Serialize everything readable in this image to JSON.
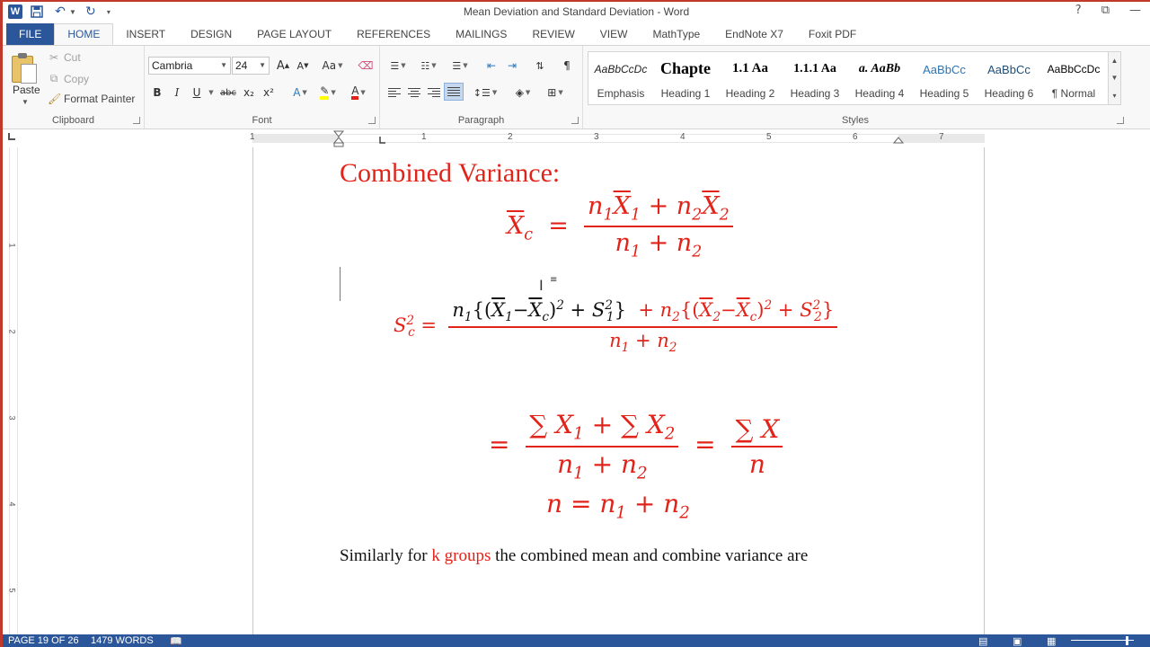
{
  "window": {
    "title": "Mean Deviation and Standard Deviation - Word",
    "controls": [
      "?",
      "⧉",
      "—"
    ]
  },
  "quick_access": {
    "app_logo": "W",
    "save_icon": "save-icon",
    "undo_icon": "undo-icon",
    "redo_icon": "redo-icon"
  },
  "tabs": [
    {
      "label": "FILE"
    },
    {
      "label": "HOME"
    },
    {
      "label": "INSERT"
    },
    {
      "label": "DESIGN"
    },
    {
      "label": "PAGE LAYOUT"
    },
    {
      "label": "REFERENCES"
    },
    {
      "label": "MAILINGS"
    },
    {
      "label": "REVIEW"
    },
    {
      "label": "VIEW"
    },
    {
      "label": "MathType"
    },
    {
      "label": "EndNote X7"
    },
    {
      "label": "Foxit PDF"
    }
  ],
  "clipboard": {
    "paste": "Paste",
    "cut": "Cut",
    "copy": "Copy",
    "format_painter": "Format Painter",
    "group_label": "Clipboard"
  },
  "font": {
    "font_name": "Cambria",
    "font_size": "24",
    "grow": "A",
    "shrink": "A",
    "change_case": "Aa",
    "bold": "B",
    "italic": "I",
    "underline": "U",
    "strikethrough": "abc",
    "subscript": "x₂",
    "superscript": "x²",
    "text_effects": "A",
    "font_color": "A",
    "group_label": "Font"
  },
  "paragraph": {
    "show_marks": "¶",
    "group_label": "Paragraph"
  },
  "styles": {
    "items": [
      {
        "sample": "AaBbCcDc",
        "name": "Emphasis"
      },
      {
        "sample": "Chapte",
        "name": "Heading 1"
      },
      {
        "sample": "1.1  Aa",
        "name": "Heading 2"
      },
      {
        "sample": "1.1.1  Aa",
        "name": "Heading 3"
      },
      {
        "sample": "a.  AaBb",
        "name": "Heading 4"
      },
      {
        "sample": "AaBbCc",
        "name": "Heading 5"
      },
      {
        "sample": "AaBbCc",
        "name": "Heading 6"
      },
      {
        "sample": "AaBbCcDc",
        "name": "¶ Normal"
      }
    ],
    "group_label": "Styles"
  },
  "ruler": {
    "numbers": [
      "1",
      "1",
      "2",
      "3",
      "4",
      "5",
      "6",
      "7"
    ],
    "vertical_numbers": [
      "1",
      "2",
      "3",
      "4",
      "5"
    ]
  },
  "document": {
    "heading": "Combined Variance:",
    "para_before": "Similarly for ",
    "para_highlight": "k groups",
    "para_after": " the combined mean and combine variance are"
  },
  "statusbar": {
    "page": "PAGE 19 OF 26",
    "words": "1479 WORDS"
  },
  "colors": {
    "accent": "#2b579a",
    "equation_red": "#e2231a"
  }
}
